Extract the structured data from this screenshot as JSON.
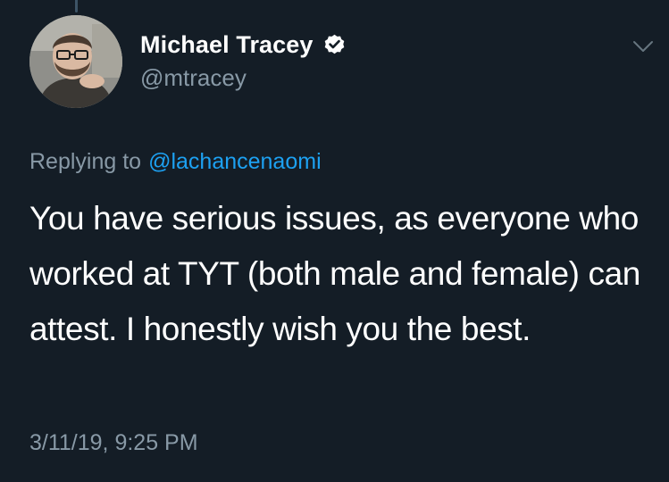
{
  "tweet": {
    "author": {
      "display_name": "Michael Tracey",
      "handle": "@mtracey",
      "verified": true,
      "avatar": "avatar-photo"
    },
    "reply": {
      "prefix": "Replying to",
      "handle": "@lachancenaomi"
    },
    "text": "You have serious issues, as everyone who worked at TYT (both male and female) can attest. I honestly wish you the best.",
    "timestamp": "3/11/19, 9:25 PM",
    "icons": {
      "verified": "verified-badge-icon",
      "menu": "chevron-down-icon"
    }
  },
  "colors": {
    "background": "#141d26",
    "primary_text": "#ffffff",
    "secondary_text": "#8899a6",
    "link": "#1da1f2"
  }
}
